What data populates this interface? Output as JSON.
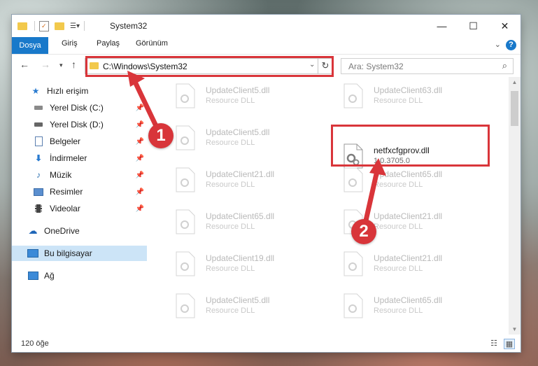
{
  "window": {
    "title": "System32",
    "controls": {
      "minimize": "—",
      "maximize": "☐",
      "close": "✕"
    }
  },
  "ribbon": {
    "tabs": [
      "Dosya",
      "Giriş",
      "Paylaş",
      "Görünüm"
    ],
    "help_label": "?"
  },
  "navigation": {
    "address": "C:\\Windows\\System32",
    "search_placeholder": "Ara: System32"
  },
  "sidebar": {
    "items": [
      {
        "label": "Hızlı erişim",
        "icon": "star-icon"
      },
      {
        "label": "Yerel Disk (C:)",
        "icon": "drive-icon"
      },
      {
        "label": "Yerel Disk (D:)",
        "icon": "drive-icon"
      },
      {
        "label": "Belgeler",
        "icon": "documents-icon"
      },
      {
        "label": "İndirmeler",
        "icon": "download-icon"
      },
      {
        "label": "Müzik",
        "icon": "music-icon"
      },
      {
        "label": "Resimler",
        "icon": "pictures-icon"
      },
      {
        "label": "Videolar",
        "icon": "video-icon"
      },
      {
        "label": "OneDrive",
        "icon": "cloud-icon"
      },
      {
        "label": "Bu bilgisayar",
        "icon": "computer-icon"
      },
      {
        "label": "Ağ",
        "icon": "network-icon"
      }
    ]
  },
  "files": [
    {
      "name": "UpdateClient5.dll",
      "desc": "Resource DLL"
    },
    {
      "name": "UpdateClient63.dll",
      "desc": "Resource DLL"
    },
    {
      "name": "UpdateClient5.dll",
      "desc": "Resource DLL"
    },
    {
      "name": "netfxcfgprov.dll",
      "desc": "1.0.3705.0"
    },
    {
      "name": "UpdateClient21.dll",
      "desc": "Resource DLL"
    },
    {
      "name": "UpdateClient65.dll",
      "desc": "Resource DLL"
    },
    {
      "name": "UpdateClient65.dll",
      "desc": "Resource DLL"
    },
    {
      "name": "UpdateClient21.dll",
      "desc": "Resource DLL"
    },
    {
      "name": "UpdateClient19.dll",
      "desc": "Resource DLL"
    },
    {
      "name": "UpdateClient21.dll",
      "desc": "Resource DLL"
    },
    {
      "name": "UpdateClient5.dll",
      "desc": "Resource DLL"
    },
    {
      "name": "UpdateClient65.dll",
      "desc": "Resource DLL"
    }
  ],
  "status": {
    "item_count": "120 öğe"
  },
  "annotations": {
    "badge1": "1",
    "badge2": "2",
    "color": "#d9353a"
  }
}
